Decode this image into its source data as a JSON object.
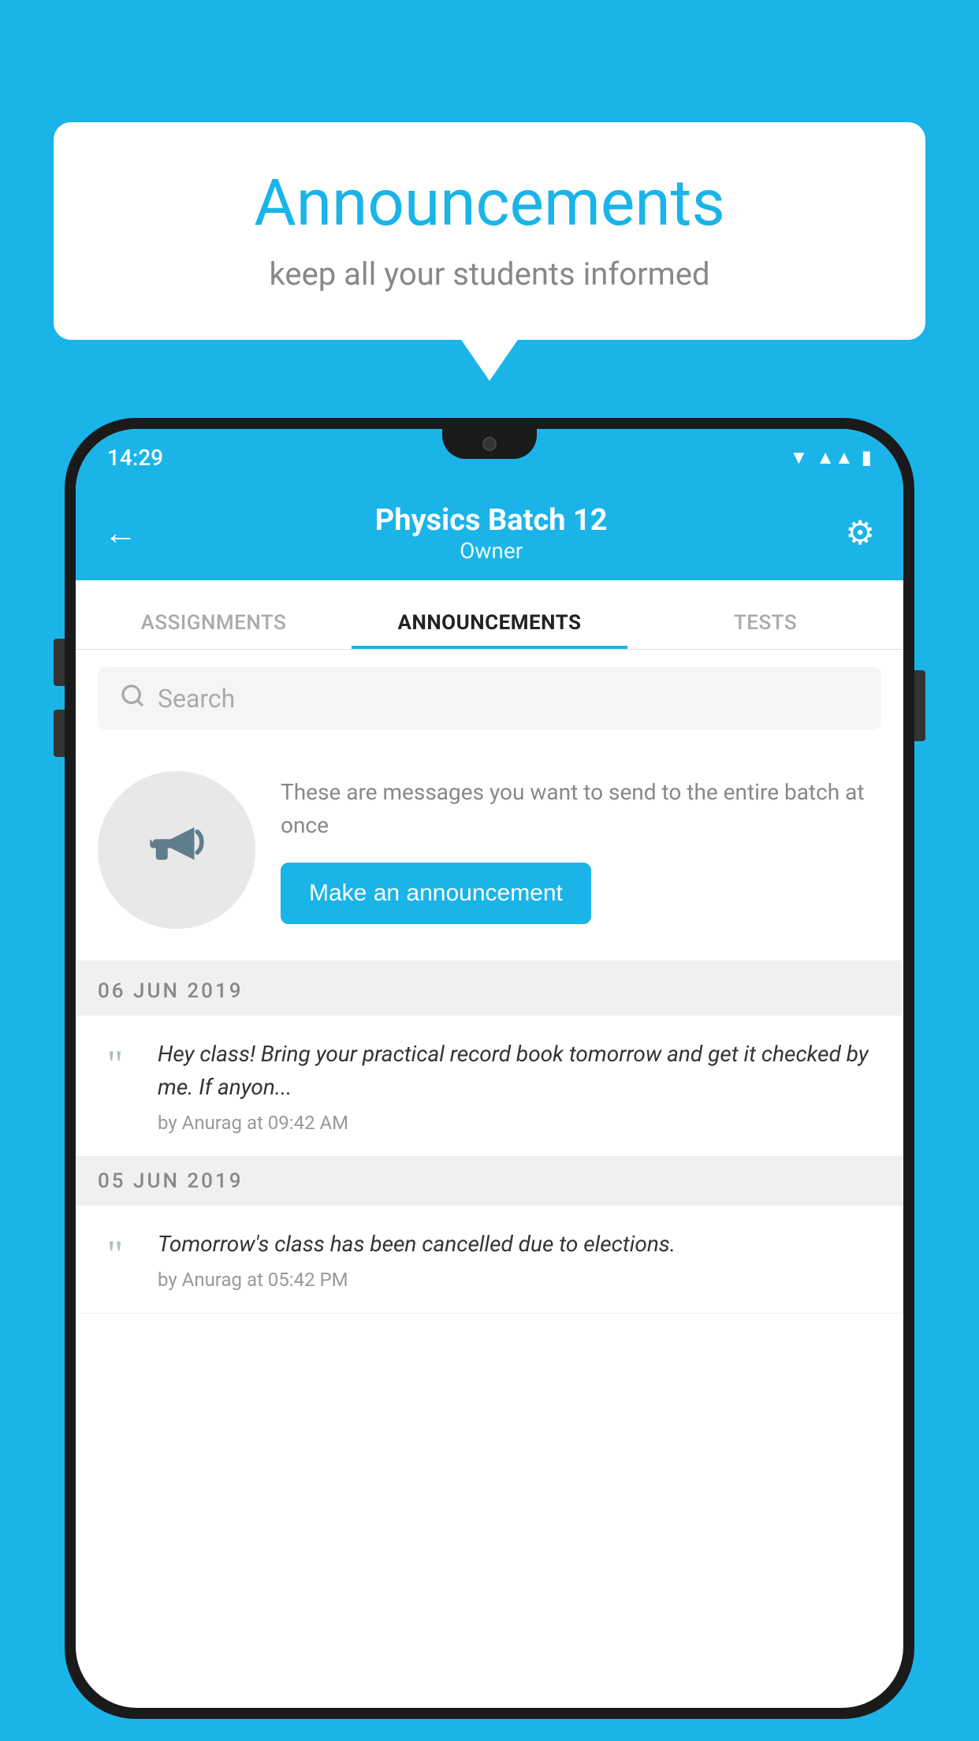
{
  "page": {
    "background_color": "#1ab4e8"
  },
  "speech_bubble": {
    "title": "Announcements",
    "subtitle": "keep all your students informed"
  },
  "status_bar": {
    "time": "14:29",
    "wifi_icon": "wifi-icon",
    "signal_icon": "signal-icon",
    "battery_icon": "battery-icon"
  },
  "header": {
    "back_label": "←",
    "title": "Physics Batch 12",
    "subtitle": "Owner",
    "gear_icon": "gear-icon"
  },
  "tabs": [
    {
      "label": "ASSIGNMENTS",
      "active": false
    },
    {
      "label": "ANNOUNCEMENTS",
      "active": true
    },
    {
      "label": "TESTS",
      "active": false
    }
  ],
  "search": {
    "placeholder": "Search"
  },
  "promo": {
    "text": "These are messages you want to send to the entire batch at once",
    "button_label": "Make an announcement"
  },
  "announcements": [
    {
      "date": "06  JUN  2019",
      "text": "Hey class! Bring your practical record book tomorrow and get it checked by me. If anyon...",
      "meta": "by Anurag at 09:42 AM"
    },
    {
      "date": "05  JUN  2019",
      "text": "Tomorrow's class has been cancelled due to elections.",
      "meta": "by Anurag at 05:42 PM"
    }
  ]
}
